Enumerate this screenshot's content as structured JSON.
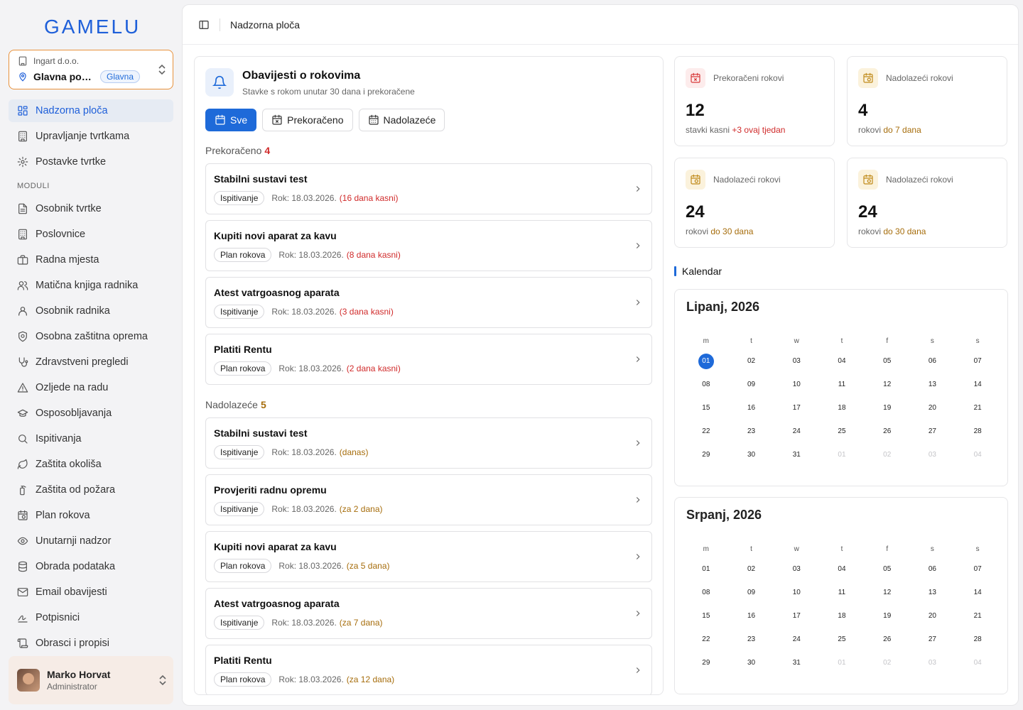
{
  "brand": {
    "name": "GAMELU",
    "color": "#1e5fd9"
  },
  "company": {
    "org": "Ingart d.o.o.",
    "branch": "Glavna posl...",
    "badge": "Glavna"
  },
  "nav": [
    {
      "label": "Nadzorna ploča",
      "icon": "dashboard-icon",
      "active": true
    },
    {
      "label": "Upravljanje tvrtkama",
      "icon": "building-icon"
    },
    {
      "label": "Postavke tvrtke",
      "icon": "gear-icon"
    }
  ],
  "modules_label": "MODULI",
  "modules": [
    {
      "label": "Osobnik tvrtke",
      "icon": "document-icon"
    },
    {
      "label": "Poslovnice",
      "icon": "building-icon"
    },
    {
      "label": "Radna mjesta",
      "icon": "briefcase-icon"
    },
    {
      "label": "Matična knjiga radnika",
      "icon": "users-icon"
    },
    {
      "label": "Osobnik radnika",
      "icon": "user-icon"
    },
    {
      "label": "Osobna zaštitna oprema",
      "icon": "shield-icon"
    },
    {
      "label": "Zdravstveni pregledi",
      "icon": "stethoscope-icon"
    },
    {
      "label": "Ozljede na radu",
      "icon": "warning-icon"
    },
    {
      "label": "Osposobljavanja",
      "icon": "graduation-icon"
    },
    {
      "label": "Ispitivanja",
      "icon": "search-icon"
    },
    {
      "label": "Zaštita okoliša",
      "icon": "leaf-icon"
    },
    {
      "label": "Zaštita od požara",
      "icon": "fire-extinguisher-icon"
    },
    {
      "label": "Plan rokova",
      "icon": "calendar-clock-icon"
    },
    {
      "label": "Unutarnji nadzor",
      "icon": "eye-icon"
    },
    {
      "label": "Obrada podataka",
      "icon": "database-icon"
    },
    {
      "label": "Email obavijesti",
      "icon": "mail-icon"
    },
    {
      "label": "Potpisnici",
      "icon": "signature-icon"
    },
    {
      "label": "Obrasci i propisi",
      "icon": "scroll-icon"
    }
  ],
  "user": {
    "name": "Marko Horvat",
    "role": "Administrator"
  },
  "topbar": {
    "title": "Nadzorna ploča"
  },
  "panel": {
    "title": "Obavijesti o rokovima",
    "subtitle": "Stavke s rokom unutar 30 dana i prekoračene",
    "filters": [
      {
        "label": "Sve",
        "icon": "calendar-icon",
        "active": true
      },
      {
        "label": "Prekoračeno",
        "icon": "calendar-x-icon"
      },
      {
        "label": "Nadolazeće",
        "icon": "calendar-days-icon"
      }
    ],
    "overdue": {
      "label": "Prekoračeno",
      "count": "4",
      "items": [
        {
          "title": "Stabilni sustavi test",
          "tag": "Ispitivanje",
          "due": "Rok: 18.03.2026.",
          "status": "(16 dana kasni)"
        },
        {
          "title": "Kupiti novi aparat za kavu",
          "tag": "Plan rokova",
          "due": "Rok: 18.03.2026.",
          "status": "(8 dana kasni)"
        },
        {
          "title": "Atest vatrgoasnog aparata",
          "tag": "Ispitivanje",
          "due": "Rok: 18.03.2026.",
          "status": "(3 dana kasni)"
        },
        {
          "title": "Platiti Rentu",
          "tag": "Plan rokova",
          "due": "Rok: 18.03.2026.",
          "status": "(2 dana kasni)"
        }
      ]
    },
    "upcoming": {
      "label": "Nadolazeće",
      "count": "5",
      "items": [
        {
          "title": "Stabilni sustavi test",
          "tag": "Ispitivanje",
          "due": "Rok: 18.03.2026.",
          "status": "(danas)"
        },
        {
          "title": "Provjeriti radnu opremu",
          "tag": "Ispitivanje",
          "due": "Rok: 18.03.2026.",
          "status": "(za 2 dana)"
        },
        {
          "title": "Kupiti novi aparat za kavu",
          "tag": "Plan rokova",
          "due": "Rok: 18.03.2026.",
          "status": "(za 5 dana)"
        },
        {
          "title": "Atest vatrgoasnog aparata",
          "tag": "Ispitivanje",
          "due": "Rok: 18.03.2026.",
          "status": "(za 7 dana)"
        },
        {
          "title": "Platiti Rentu",
          "tag": "Plan rokova",
          "due": "Rok: 18.03.2026.",
          "status": "(za 12 dana)"
        }
      ]
    }
  },
  "stats": [
    {
      "label": "Prekoračeni rokovi",
      "value": "12",
      "foot": "stavki kasni",
      "highlight": "+3 ovaj tjedan",
      "tone": "red"
    },
    {
      "label": "Nadolazeći rokovi",
      "value": "4",
      "foot": "rokovi",
      "highlight": "do 7 dana",
      "tone": "amber"
    },
    {
      "label": "Nadolazeći rokovi",
      "value": "24",
      "foot": "rokovi",
      "highlight": "do 30 dana",
      "tone": "amber"
    },
    {
      "label": "Nadolazeći rokovi",
      "value": "24",
      "foot": "rokovi",
      "highlight": "do 30 dana",
      "tone": "amber"
    }
  ],
  "calendar": {
    "heading": "Kalendar",
    "weekdays": [
      "m",
      "t",
      "w",
      "t",
      "f",
      "s",
      "s"
    ],
    "months": [
      {
        "title": "Lipanj, 2026",
        "days": [
          "01",
          "02",
          "03",
          "04",
          "05",
          "06",
          "07",
          "08",
          "09",
          "10",
          "11",
          "12",
          "13",
          "14",
          "15",
          "16",
          "17",
          "18",
          "19",
          "20",
          "21",
          "22",
          "23",
          "24",
          "25",
          "26",
          "27",
          "28",
          "29",
          "30",
          "31"
        ],
        "trailing": [
          "01",
          "02",
          "03",
          "04"
        ],
        "today": "01"
      },
      {
        "title": "Srpanj, 2026",
        "days": [
          "01",
          "02",
          "03",
          "04",
          "05",
          "06",
          "07",
          "08",
          "09",
          "10",
          "11",
          "12",
          "13",
          "14",
          "15",
          "16",
          "17",
          "18",
          "19",
          "20",
          "21",
          "22",
          "23",
          "24",
          "25",
          "26",
          "27",
          "28",
          "29",
          "30",
          "31"
        ],
        "trailing": [
          "01",
          "02",
          "03",
          "04"
        ],
        "today": ""
      }
    ]
  }
}
